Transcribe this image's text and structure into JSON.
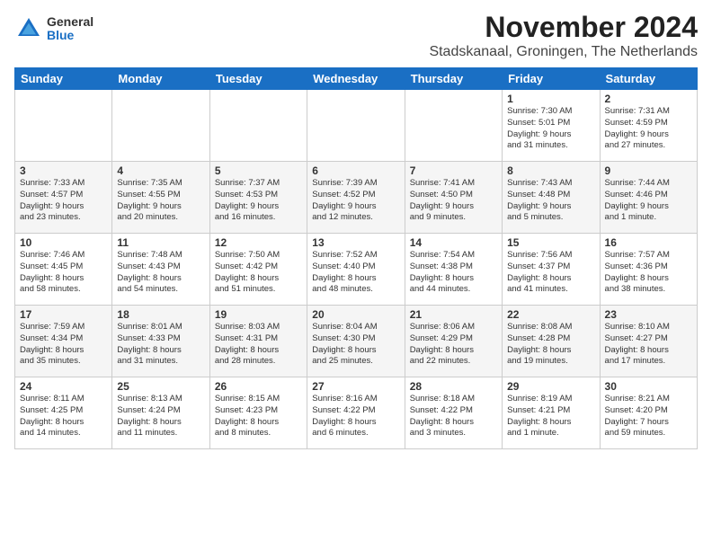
{
  "header": {
    "logo_line1": "General",
    "logo_line2": "Blue",
    "month": "November 2024",
    "location": "Stadskanaal, Groningen, The Netherlands"
  },
  "weekdays": [
    "Sunday",
    "Monday",
    "Tuesday",
    "Wednesday",
    "Thursday",
    "Friday",
    "Saturday"
  ],
  "weeks": [
    [
      {
        "day": "",
        "info": ""
      },
      {
        "day": "",
        "info": ""
      },
      {
        "day": "",
        "info": ""
      },
      {
        "day": "",
        "info": ""
      },
      {
        "day": "",
        "info": ""
      },
      {
        "day": "1",
        "info": "Sunrise: 7:30 AM\nSunset: 5:01 PM\nDaylight: 9 hours\nand 31 minutes."
      },
      {
        "day": "2",
        "info": "Sunrise: 7:31 AM\nSunset: 4:59 PM\nDaylight: 9 hours\nand 27 minutes."
      }
    ],
    [
      {
        "day": "3",
        "info": "Sunrise: 7:33 AM\nSunset: 4:57 PM\nDaylight: 9 hours\nand 23 minutes."
      },
      {
        "day": "4",
        "info": "Sunrise: 7:35 AM\nSunset: 4:55 PM\nDaylight: 9 hours\nand 20 minutes."
      },
      {
        "day": "5",
        "info": "Sunrise: 7:37 AM\nSunset: 4:53 PM\nDaylight: 9 hours\nand 16 minutes."
      },
      {
        "day": "6",
        "info": "Sunrise: 7:39 AM\nSunset: 4:52 PM\nDaylight: 9 hours\nand 12 minutes."
      },
      {
        "day": "7",
        "info": "Sunrise: 7:41 AM\nSunset: 4:50 PM\nDaylight: 9 hours\nand 9 minutes."
      },
      {
        "day": "8",
        "info": "Sunrise: 7:43 AM\nSunset: 4:48 PM\nDaylight: 9 hours\nand 5 minutes."
      },
      {
        "day": "9",
        "info": "Sunrise: 7:44 AM\nSunset: 4:46 PM\nDaylight: 9 hours\nand 1 minute."
      }
    ],
    [
      {
        "day": "10",
        "info": "Sunrise: 7:46 AM\nSunset: 4:45 PM\nDaylight: 8 hours\nand 58 minutes."
      },
      {
        "day": "11",
        "info": "Sunrise: 7:48 AM\nSunset: 4:43 PM\nDaylight: 8 hours\nand 54 minutes."
      },
      {
        "day": "12",
        "info": "Sunrise: 7:50 AM\nSunset: 4:42 PM\nDaylight: 8 hours\nand 51 minutes."
      },
      {
        "day": "13",
        "info": "Sunrise: 7:52 AM\nSunset: 4:40 PM\nDaylight: 8 hours\nand 48 minutes."
      },
      {
        "day": "14",
        "info": "Sunrise: 7:54 AM\nSunset: 4:38 PM\nDaylight: 8 hours\nand 44 minutes."
      },
      {
        "day": "15",
        "info": "Sunrise: 7:56 AM\nSunset: 4:37 PM\nDaylight: 8 hours\nand 41 minutes."
      },
      {
        "day": "16",
        "info": "Sunrise: 7:57 AM\nSunset: 4:36 PM\nDaylight: 8 hours\nand 38 minutes."
      }
    ],
    [
      {
        "day": "17",
        "info": "Sunrise: 7:59 AM\nSunset: 4:34 PM\nDaylight: 8 hours\nand 35 minutes."
      },
      {
        "day": "18",
        "info": "Sunrise: 8:01 AM\nSunset: 4:33 PM\nDaylight: 8 hours\nand 31 minutes."
      },
      {
        "day": "19",
        "info": "Sunrise: 8:03 AM\nSunset: 4:31 PM\nDaylight: 8 hours\nand 28 minutes."
      },
      {
        "day": "20",
        "info": "Sunrise: 8:04 AM\nSunset: 4:30 PM\nDaylight: 8 hours\nand 25 minutes."
      },
      {
        "day": "21",
        "info": "Sunrise: 8:06 AM\nSunset: 4:29 PM\nDaylight: 8 hours\nand 22 minutes."
      },
      {
        "day": "22",
        "info": "Sunrise: 8:08 AM\nSunset: 4:28 PM\nDaylight: 8 hours\nand 19 minutes."
      },
      {
        "day": "23",
        "info": "Sunrise: 8:10 AM\nSunset: 4:27 PM\nDaylight: 8 hours\nand 17 minutes."
      }
    ],
    [
      {
        "day": "24",
        "info": "Sunrise: 8:11 AM\nSunset: 4:25 PM\nDaylight: 8 hours\nand 14 minutes."
      },
      {
        "day": "25",
        "info": "Sunrise: 8:13 AM\nSunset: 4:24 PM\nDaylight: 8 hours\nand 11 minutes."
      },
      {
        "day": "26",
        "info": "Sunrise: 8:15 AM\nSunset: 4:23 PM\nDaylight: 8 hours\nand 8 minutes."
      },
      {
        "day": "27",
        "info": "Sunrise: 8:16 AM\nSunset: 4:22 PM\nDaylight: 8 hours\nand 6 minutes."
      },
      {
        "day": "28",
        "info": "Sunrise: 8:18 AM\nSunset: 4:22 PM\nDaylight: 8 hours\nand 3 minutes."
      },
      {
        "day": "29",
        "info": "Sunrise: 8:19 AM\nSunset: 4:21 PM\nDaylight: 8 hours\nand 1 minute."
      },
      {
        "day": "30",
        "info": "Sunrise: 8:21 AM\nSunset: 4:20 PM\nDaylight: 7 hours\nand 59 minutes."
      }
    ]
  ]
}
